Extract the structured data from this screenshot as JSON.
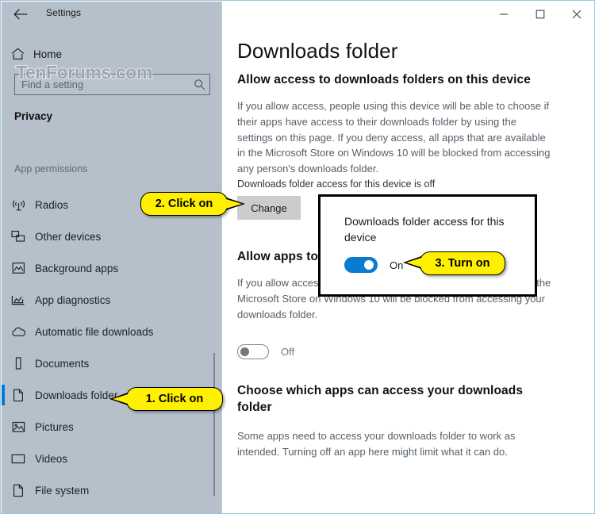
{
  "window": {
    "app_title": "Settings",
    "back_icon": "back-arrow-icon",
    "controls": {
      "minimize": "minimize-icon",
      "maximize": "maximize-icon",
      "close": "close-icon"
    }
  },
  "sidebar": {
    "home_label": "Home",
    "home_icon": "home-icon",
    "search": {
      "placeholder": "Find a setting",
      "value": "",
      "icon": "search-icon"
    },
    "watermark": "TenForums.com",
    "category": "Privacy",
    "group_label": "App permissions",
    "items": [
      {
        "label": "Radios",
        "icon": "radios-icon",
        "selected": false
      },
      {
        "label": "Other devices",
        "icon": "other-devices-icon",
        "selected": false
      },
      {
        "label": "Background apps",
        "icon": "background-apps-icon",
        "selected": false
      },
      {
        "label": "App diagnostics",
        "icon": "app-diagnostics-icon",
        "selected": false
      },
      {
        "label": "Automatic file downloads",
        "icon": "cloud-download-icon",
        "selected": false
      },
      {
        "label": "Documents",
        "icon": "documents-icon",
        "selected": false
      },
      {
        "label": "Downloads folder",
        "icon": "downloads-folder-icon",
        "selected": true
      },
      {
        "label": "Pictures",
        "icon": "pictures-icon",
        "selected": false
      },
      {
        "label": "Videos",
        "icon": "videos-icon",
        "selected": false
      },
      {
        "label": "File system",
        "icon": "file-system-icon",
        "selected": false
      }
    ]
  },
  "main": {
    "page_title": "Downloads folder",
    "section_device": {
      "heading": "Allow access to downloads folders on this device",
      "body": "If you allow access, people using this device will be able to choose if their apps have access to their downloads folder by using the settings on this page. If you deny access, all apps that are available in the Microsoft Store on Windows 10 will be blocked from accessing any person's downloads folder.",
      "status": "Downloads folder access for this device is off",
      "change_button": "Change"
    },
    "section_apps": {
      "heading": "Allow apps to",
      "body": "If you allow access, downloads folder b apps that are available in the Microsoft Store on Windows 10 will be blocked from accessing your downloads folder.",
      "toggle_state": "Off"
    },
    "section_choose": {
      "heading": "Choose which apps can access your downloads folder",
      "body": "Some apps need to access your downloads folder to work as intended. Turning off an app here might limit what it can do."
    }
  },
  "popup": {
    "label": "Downloads folder access for this device",
    "toggle_state": "On"
  },
  "callouts": [
    {
      "text": "1. Click on"
    },
    {
      "text": "2. Click on"
    },
    {
      "text": "3. Turn on"
    }
  ],
  "colors": {
    "accent": "#0078d7",
    "toggle_on": "#0a7bd1",
    "sidebar_bg": "#b5c0ca",
    "callout_bg": "#ffef00",
    "window_border": "#9ec5db"
  }
}
